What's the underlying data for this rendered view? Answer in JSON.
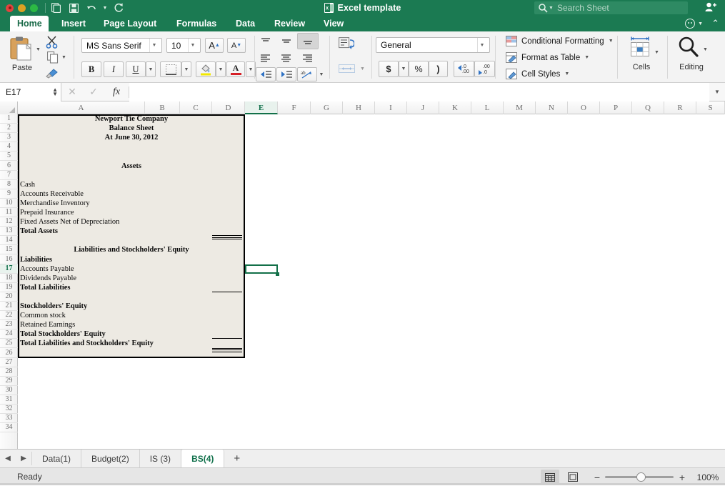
{
  "window": {
    "title": "Excel template",
    "app_badge": "X",
    "traffic_lights": [
      "close-red",
      "minimize-yellow",
      "zoom-green"
    ],
    "quick_access": [
      "new-document-icon",
      "save-icon",
      "undo-icon",
      "undo-dropdown-icon",
      "redo-icon"
    ]
  },
  "search": {
    "placeholder": "Search Sheet",
    "icon": "search-icon"
  },
  "account": {
    "icon": "add-user-icon"
  },
  "ribbon_tabs": {
    "items": [
      {
        "label": "Home",
        "active": true
      },
      {
        "label": "Insert",
        "active": false
      },
      {
        "label": "Page Layout",
        "active": false
      },
      {
        "label": "Formulas",
        "active": false
      },
      {
        "label": "Data",
        "active": false
      },
      {
        "label": "Review",
        "active": false
      },
      {
        "label": "View",
        "active": false
      }
    ],
    "right": {
      "smiley": "smiley-face-icon",
      "collapse": "collapse-ribbon-icon"
    }
  },
  "ribbon": {
    "clipboard": {
      "paste_label": "Paste",
      "cut_icon": "scissors-icon",
      "copy_icon": "copy-icon",
      "format_painter_icon": "format-painter-icon"
    },
    "font": {
      "family": "MS Sans Serif",
      "size": "10",
      "grow_label": "A",
      "shrink_label": "A",
      "bold": "B",
      "italic": "I",
      "underline": "U",
      "borders_icon": "borders-icon",
      "fill_icon": "fill-color-icon",
      "font_color_icon": "font-color-icon",
      "fill_color": "#f2e800",
      "font_color": "#d61f26"
    },
    "alignment": {
      "top_icon": "align-top-icon",
      "middle_icon": "align-middle-icon",
      "bottom_icon": "align-bottom-icon",
      "left_icon": "align-left-icon",
      "center_icon": "align-center-icon",
      "right_icon": "align-right-icon",
      "decrease_indent_icon": "decrease-indent-icon",
      "increase_indent_icon": "increase-indent-icon",
      "orientation_icon": "text-orientation-icon"
    },
    "wrap": {
      "wrap_text_icon": "wrap-text-icon",
      "merge_icon": "merge-cells-icon"
    },
    "number": {
      "format": "General",
      "currency": "$",
      "percent": "%",
      "comma": ")",
      "increase_decimal": ".00",
      "decrease_decimal": ".00"
    },
    "styles": {
      "conditional_formatting": "Conditional Formatting",
      "format_as_table": "Format as Table",
      "cell_styles": "Cell Styles"
    },
    "cells": {
      "label": "Cells",
      "icon": "cells-icon"
    },
    "editing": {
      "label": "Editing",
      "icon": "magnifier-icon"
    }
  },
  "formula_bar": {
    "name_box": "E17",
    "cancel_icon": "cancel-icon",
    "confirm_icon": "confirm-icon",
    "function_icon": "fx",
    "formula": "",
    "expand_icon": "expand-formula-bar-icon"
  },
  "grid": {
    "columns": [
      "A",
      "B",
      "C",
      "D",
      "E",
      "F",
      "G",
      "H",
      "I",
      "J",
      "K",
      "L",
      "M",
      "N",
      "O",
      "P",
      "Q",
      "R",
      "S"
    ],
    "selected_column": "E",
    "selected_row": 17,
    "active_cell": "E17",
    "rows": [
      1,
      2,
      3,
      4,
      5,
      6,
      7,
      8,
      9,
      10,
      11,
      12,
      13,
      14,
      15,
      16,
      17,
      18,
      19,
      20,
      21,
      22,
      23,
      24,
      25,
      26,
      27,
      28,
      29,
      30,
      31,
      32,
      33,
      34
    ],
    "cells": [
      {
        "row": 1,
        "text": "Newport Tie Company",
        "bold": true,
        "align": "center"
      },
      {
        "row": 2,
        "text": "Balance Sheet",
        "bold": true,
        "align": "center"
      },
      {
        "row": 3,
        "text": "At June 30, 2012",
        "bold": true,
        "align": "center"
      },
      {
        "row": 6,
        "text": "Assets",
        "bold": true,
        "align": "center"
      },
      {
        "row": 8,
        "text": "Cash",
        "bold": false,
        "align": "left"
      },
      {
        "row": 9,
        "text": "Accounts Receivable",
        "bold": false,
        "align": "left"
      },
      {
        "row": 10,
        "text": "Merchandise Inventory",
        "bold": false,
        "align": "left"
      },
      {
        "row": 11,
        "text": "Prepaid Insurance",
        "bold": false,
        "align": "left"
      },
      {
        "row": 12,
        "text": "Fixed Assets Net of Depreciation",
        "bold": false,
        "align": "left"
      },
      {
        "row": 13,
        "text": "Total Assets",
        "bold": true,
        "align": "left"
      },
      {
        "row": 15,
        "text": "Liabilities and Stockholders' Equity",
        "bold": true,
        "align": "center"
      },
      {
        "row": 16,
        "text": "Liabilities",
        "bold": true,
        "align": "left"
      },
      {
        "row": 17,
        "text": "Accounts Payable",
        "bold": false,
        "align": "left"
      },
      {
        "row": 18,
        "text": "Dividends Payable",
        "bold": false,
        "align": "left"
      },
      {
        "row": 19,
        "text": "Total Liabilities",
        "bold": true,
        "align": "left"
      },
      {
        "row": 21,
        "text": "Stockholders' Equity",
        "bold": true,
        "align": "left"
      },
      {
        "row": 22,
        "text": "Common stock",
        "bold": false,
        "align": "left"
      },
      {
        "row": 23,
        "text": "Retained Earnings",
        "bold": false,
        "align": "left"
      },
      {
        "row": 24,
        "text": "Total  Stockholders' Equity",
        "bold": true,
        "align": "left"
      },
      {
        "row": 25,
        "text": "Total Liabilities and Stockholders' Equity",
        "bold": true,
        "align": "left"
      }
    ],
    "shaded_range": "A1:D26",
    "shade_color": "#EDEAE3"
  },
  "sheet_tabs": {
    "prev_icon": "previous-sheet-icon",
    "next_icon": "next-sheet-icon",
    "items": [
      {
        "label": "Data(1)",
        "active": false
      },
      {
        "label": "Budget(2)",
        "active": false
      },
      {
        "label": "IS (3)",
        "active": false
      },
      {
        "label": "BS(4)",
        "active": true
      }
    ],
    "add_label": "+"
  },
  "status_bar": {
    "status": "Ready",
    "normal_view_icon": "normal-view-icon",
    "page_layout_icon": "page-layout-view-icon",
    "zoom_out": "−",
    "zoom_in": "+",
    "zoom_value": "100%"
  }
}
